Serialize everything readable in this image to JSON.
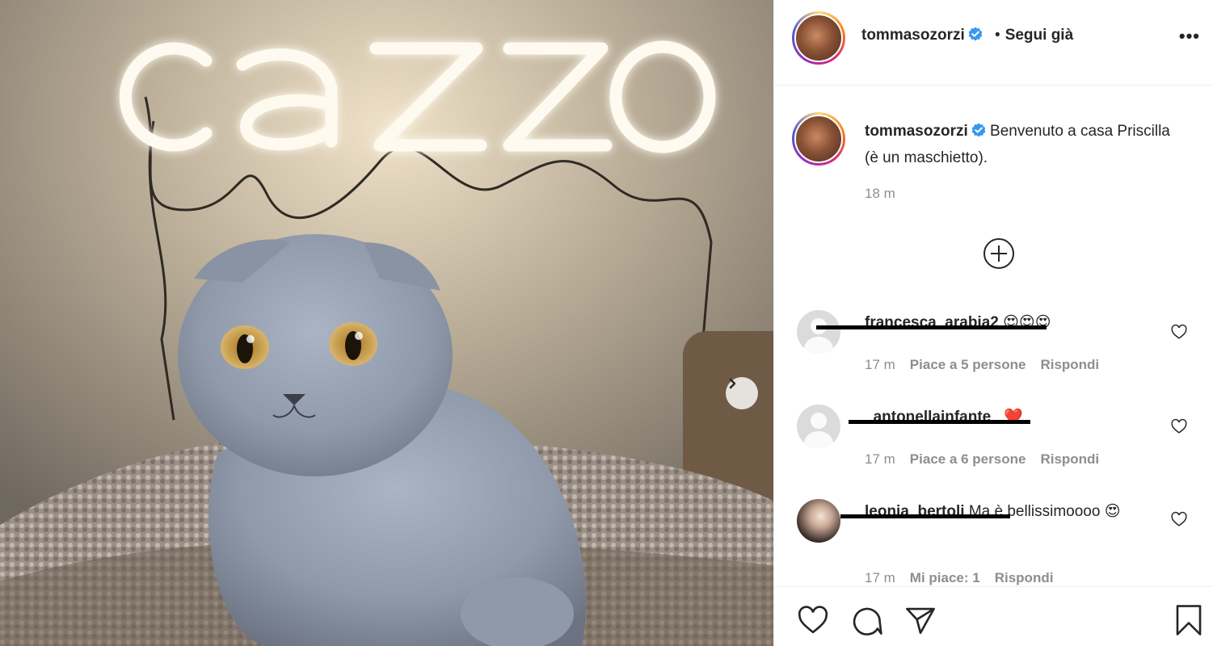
{
  "post": {
    "image": {
      "neon_sign_text": "cazzo",
      "alt_subject": "gray scottish fold kitten"
    }
  },
  "header": {
    "username": "tommasozorzi",
    "separator": "•",
    "follow_status": "Segui già",
    "more_label": "•••"
  },
  "caption": {
    "username": "tommasozorzi",
    "text": "Benvenuto a casa Priscilla (è un maschietto).",
    "time": "18 m"
  },
  "comments": [
    {
      "username": "francesca_arabia2",
      "text": "😍😍😍",
      "time": "17 m",
      "likes": "Piace a 5 persone",
      "reply": "Rispondi"
    },
    {
      "username": "_antonellainfante_",
      "text": "❤️",
      "time": "17 m",
      "likes": "Piace a 6 persone",
      "reply": "Rispondi"
    },
    {
      "username": "leonia_bertoli",
      "text": "Ma è bellissimoooo 😍",
      "time": "17 m",
      "likes": "Mi piace: 1",
      "reply": "Rispondi"
    }
  ],
  "colors": {
    "text": "#262626",
    "muted": "#8e8e8e",
    "border": "#efefef",
    "verified": "#3897f0"
  },
  "icons": {
    "carousel_next": "chevron-right-icon",
    "load_more": "plus-circle-icon",
    "like": "heart-icon",
    "comment": "speech-bubble-icon",
    "share": "paper-plane-icon",
    "save": "bookmark-icon"
  }
}
